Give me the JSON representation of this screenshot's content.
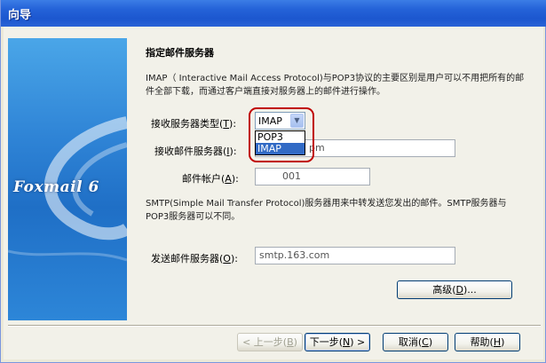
{
  "window": {
    "title": "向导"
  },
  "banner": {
    "brand": "Foxmail 6"
  },
  "page": {
    "heading": "指定邮件服务器",
    "description": "IMAP（ Interactive Mail Access Protocol)与POP3协议的主要区别是用户可以不用把所有的邮件全部下载，而通过客户端直接对服务器上的邮件进行操作。",
    "smtp_description": "SMTP(Simple Mail Transfer Protocol)服务器用来中转发送您发出的邮件。SMTP服务器与POP3服务器可以不同。"
  },
  "fields": {
    "recv_type_label": "接收服务器类型(",
    "recv_type_key": "T",
    "recv_type_value": "IMAP",
    "recv_type_options": [
      "POP3",
      "IMAP"
    ],
    "recv_server_label": "接收邮件服务器(",
    "recv_server_key": "I",
    "recv_server_value": "pm",
    "account_label": "邮件帐户(",
    "account_key": "A",
    "account_value": "001",
    "send_server_label": "发送邮件服务器(",
    "send_server_key": "O",
    "send_server_value": "smtp.163.com",
    "label_close": "):"
  },
  "buttons": {
    "advanced": "高级(",
    "advanced_key": "D",
    "advanced_tail": ")...",
    "back": "< 上一步(",
    "back_key": "B",
    "back_tail": ")",
    "next": "下一步(",
    "next_key": "N",
    "next_tail": ") >",
    "cancel": "取消(",
    "cancel_key": "C",
    "cancel_tail": ")",
    "help": "帮助(",
    "help_key": "H",
    "help_tail": ")"
  },
  "colors": {
    "titlebar": "#2462d8",
    "highlight": "#c00000",
    "selection": "#316ac5"
  }
}
